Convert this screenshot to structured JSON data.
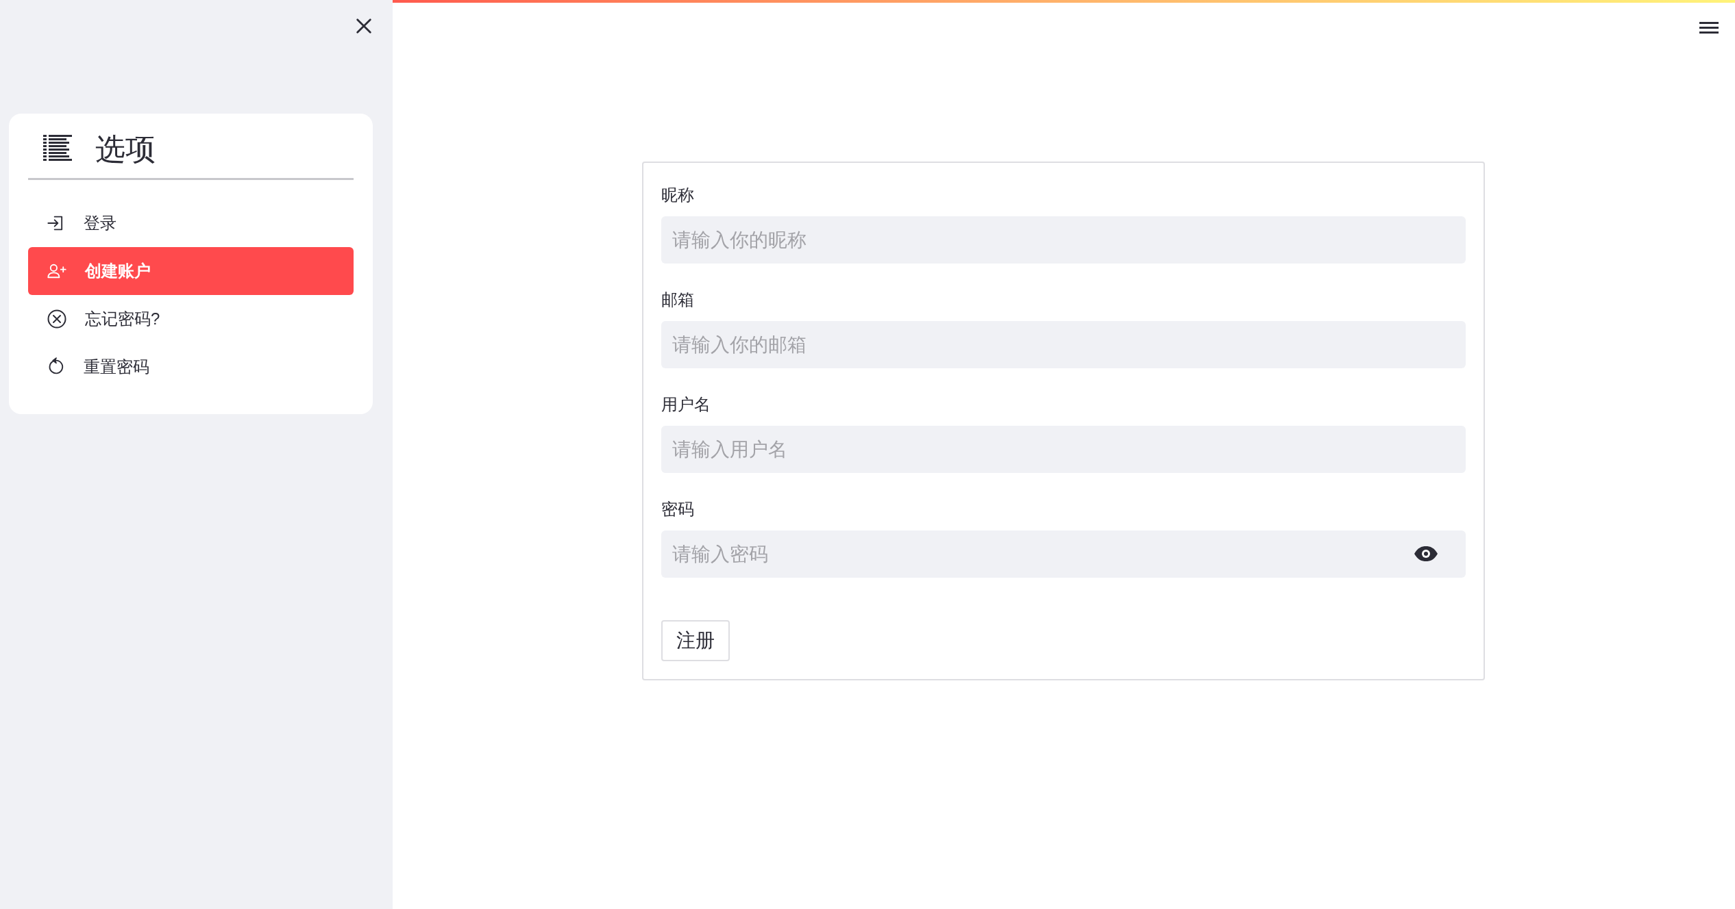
{
  "sidebar": {
    "title": "选项",
    "items": [
      {
        "label": "登录",
        "selected": false
      },
      {
        "label": "创建账户",
        "selected": true
      },
      {
        "label": "忘记密码?",
        "selected": false
      },
      {
        "label": "重置密码",
        "selected": false
      }
    ]
  },
  "form": {
    "fields": [
      {
        "kind": "text",
        "label": "昵称",
        "placeholder": "请输入你的昵称"
      },
      {
        "kind": "text",
        "label": "邮箱",
        "placeholder": "请输入你的邮箱"
      },
      {
        "kind": "text",
        "label": "用户名",
        "placeholder": "请输入用户名"
      },
      {
        "kind": "password",
        "label": "密码",
        "placeholder": "请输入密码"
      }
    ],
    "submit": "注册"
  }
}
